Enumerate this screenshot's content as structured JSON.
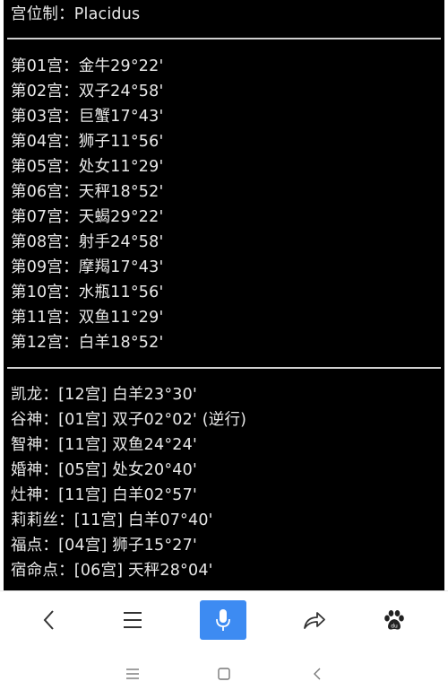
{
  "header": {
    "house_system": "宫位制：Placidus"
  },
  "houses": [
    "第01宫：金牛29°22'",
    "第02宫：双子24°58'",
    "第03宫：巨蟹17°43'",
    "第04宫：狮子11°56'",
    "第05宫：处女11°29'",
    "第06宫：天秤18°52'",
    "第07宫：天蝎29°22'",
    "第08宫：射手24°58'",
    "第09宫：摩羯17°43'",
    "第10宫：水瓶11°56'",
    "第11宫：双鱼11°29'",
    "第12宫：白羊18°52'"
  ],
  "points": [
    "凯龙：[12宫] 白羊23°30'",
    "谷神：[01宫] 双子02°02' (逆行)",
    "智神：[11宫] 双鱼24°24'",
    "婚神：[05宫] 处女20°40'",
    "灶神：[11宫] 白羊02°57'",
    "莉莉丝：[11宫] 白羊07°40'",
    "福点：[04宫] 狮子15°27'",
    "宿命点：[06宫] 天秤28°04'"
  ],
  "toolbar": {
    "items": [
      "back-icon",
      "menu-icon",
      "microphone-icon",
      "share-icon",
      "baidu-paw-icon"
    ],
    "accent_color": "#3d8bf2"
  },
  "system_nav": {
    "items": [
      "recent-apps-icon",
      "home-icon",
      "back-icon"
    ]
  }
}
